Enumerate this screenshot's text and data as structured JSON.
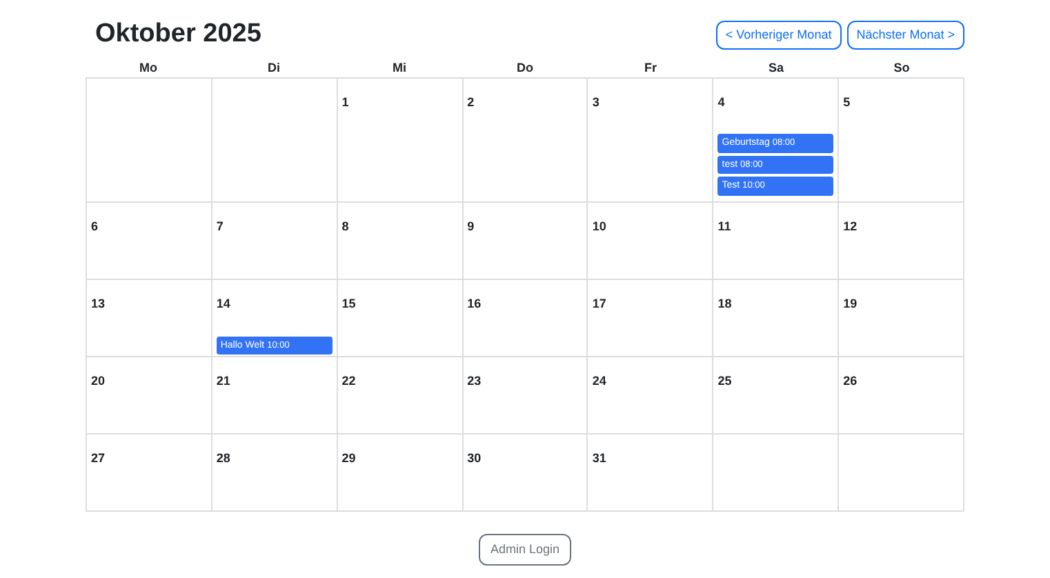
{
  "title": "Oktober 2025",
  "nav_buttons": [
    "< Vorheriger Monat",
    "Nächster Monat >"
  ],
  "weekdays": [
    "Mo",
    "Di",
    "Mi",
    "Do",
    "Fr",
    "Sa",
    "So"
  ],
  "weeks": [
    [
      {
        "kind": "blank"
      },
      {
        "kind": "blank"
      },
      {
        "kind": "day",
        "day": "1"
      },
      {
        "kind": "day",
        "day": "2"
      },
      {
        "kind": "day",
        "day": "3"
      },
      {
        "kind": "day",
        "day": "4",
        "events": [
          {
            "title": "Geburtstag",
            "time": "08:00"
          },
          {
            "title": "test",
            "time": "08:00"
          },
          {
            "title": "Test",
            "time": "10:00"
          }
        ]
      },
      {
        "kind": "day",
        "day": "5"
      }
    ],
    [
      {
        "kind": "day",
        "day": "6"
      },
      {
        "kind": "day",
        "day": "7"
      },
      {
        "kind": "day",
        "day": "8"
      },
      {
        "kind": "day",
        "day": "9"
      },
      {
        "kind": "day",
        "day": "10"
      },
      {
        "kind": "day",
        "day": "11"
      },
      {
        "kind": "day",
        "day": "12"
      }
    ],
    [
      {
        "kind": "day",
        "day": "13"
      },
      {
        "kind": "day",
        "day": "14",
        "events": [
          {
            "title": "Hallo Welt",
            "time": "10:00"
          }
        ]
      },
      {
        "kind": "day",
        "day": "15"
      },
      {
        "kind": "day",
        "day": "16"
      },
      {
        "kind": "day",
        "day": "17"
      },
      {
        "kind": "day",
        "day": "18"
      },
      {
        "kind": "day",
        "day": "19"
      }
    ],
    [
      {
        "kind": "day",
        "day": "20"
      },
      {
        "kind": "day",
        "day": "21"
      },
      {
        "kind": "day",
        "day": "22"
      },
      {
        "kind": "day",
        "day": "23"
      },
      {
        "kind": "day",
        "day": "24"
      },
      {
        "kind": "day",
        "day": "25"
      },
      {
        "kind": "day",
        "day": "26"
      }
    ],
    [
      {
        "kind": "day",
        "day": "27"
      },
      {
        "kind": "day",
        "day": "28"
      },
      {
        "kind": "day",
        "day": "29"
      },
      {
        "kind": "day",
        "day": "30"
      },
      {
        "kind": "day",
        "day": "31"
      },
      {
        "kind": "blank"
      },
      {
        "kind": "blank"
      }
    ]
  ],
  "footer_button": "Admin Login"
}
